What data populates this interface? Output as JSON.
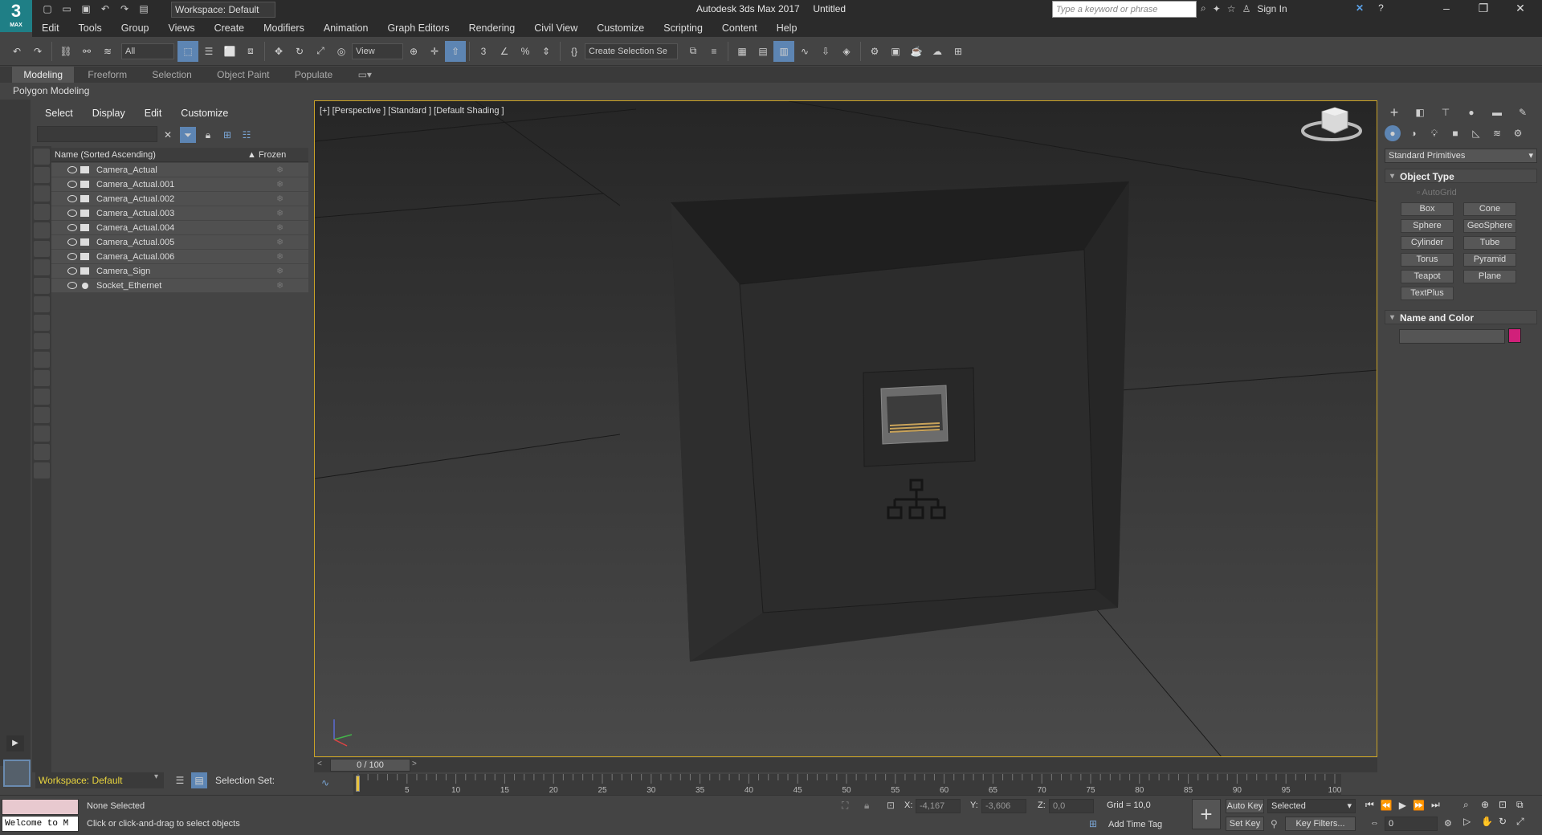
{
  "titlebar": {
    "app_title": "Autodesk 3ds Max 2017",
    "doc_title": "Untitled",
    "workspace": "Workspace: Default",
    "search_placeholder": "Type a keyword or phrase",
    "sign_in": "Sign In",
    "logo_num": "3",
    "logo_text": "MAX"
  },
  "menubar": [
    "Edit",
    "Tools",
    "Group",
    "Views",
    "Create",
    "Modifiers",
    "Animation",
    "Graph Editors",
    "Rendering",
    "Civil View",
    "Customize",
    "Scripting",
    "Content",
    "Help"
  ],
  "toolbar": {
    "filter": "All",
    "ref_coord": "View",
    "selection_set": "Create Selection Se"
  },
  "ribbon": {
    "tabs": [
      "Modeling",
      "Freeform",
      "Selection",
      "Object Paint",
      "Populate"
    ],
    "active_tab": "Modeling",
    "panel_label": "Polygon Modeling"
  },
  "scene_explorer": {
    "menu": [
      "Select",
      "Display",
      "Edit",
      "Customize"
    ],
    "col_name": "Name (Sorted Ascending)",
    "col_frozen": "Frozen",
    "items": [
      {
        "name": "Camera_Actual",
        "type": "camera"
      },
      {
        "name": "Camera_Actual.001",
        "type": "camera"
      },
      {
        "name": "Camera_Actual.002",
        "type": "camera"
      },
      {
        "name": "Camera_Actual.003",
        "type": "camera"
      },
      {
        "name": "Camera_Actual.004",
        "type": "camera"
      },
      {
        "name": "Camera_Actual.005",
        "type": "camera"
      },
      {
        "name": "Camera_Actual.006",
        "type": "camera"
      },
      {
        "name": "Camera_Sign",
        "type": "camera"
      },
      {
        "name": "Socket_Ethernet",
        "type": "geometry"
      }
    ],
    "workspace": "Workspace: Default",
    "selection_set_label": "Selection Set:"
  },
  "viewport": {
    "label": "[+] [Perspective ] [Standard ] [Default Shading ]",
    "border_color": "#c9a227"
  },
  "timeline": {
    "frame_display": "0 / 100",
    "ticks": [
      "5",
      "10",
      "15",
      "20",
      "25",
      "30",
      "35",
      "40",
      "45",
      "50",
      "55",
      "60",
      "65",
      "70",
      "75",
      "80",
      "85",
      "90",
      "95",
      "100"
    ]
  },
  "command_panel": {
    "category": "Standard Primitives",
    "object_type_title": "Object Type",
    "autogrid": "AutoGrid",
    "buttons": [
      "Box",
      "Cone",
      "Sphere",
      "GeoSphere",
      "Cylinder",
      "Tube",
      "Torus",
      "Pyramid",
      "Teapot",
      "Plane",
      "TextPlus"
    ],
    "name_color_title": "Name and Color",
    "swatch_color": "#d1207a"
  },
  "status": {
    "listener": "Welcome to M",
    "selection": "None Selected",
    "prompt": "Click or click-and-drag to select objects",
    "x_label": "X:",
    "x_value": "-4,167",
    "y_label": "Y:",
    "y_value": "-3,606",
    "z_label": "Z:",
    "z_value": "0,0",
    "grid": "Grid = 10,0",
    "add_time_tag": "Add Time Tag",
    "auto_key": "Auto Key",
    "set_key": "Set Key",
    "key_mode": "Selected",
    "key_filters": "Key Filters...",
    "current_frame": "0"
  }
}
